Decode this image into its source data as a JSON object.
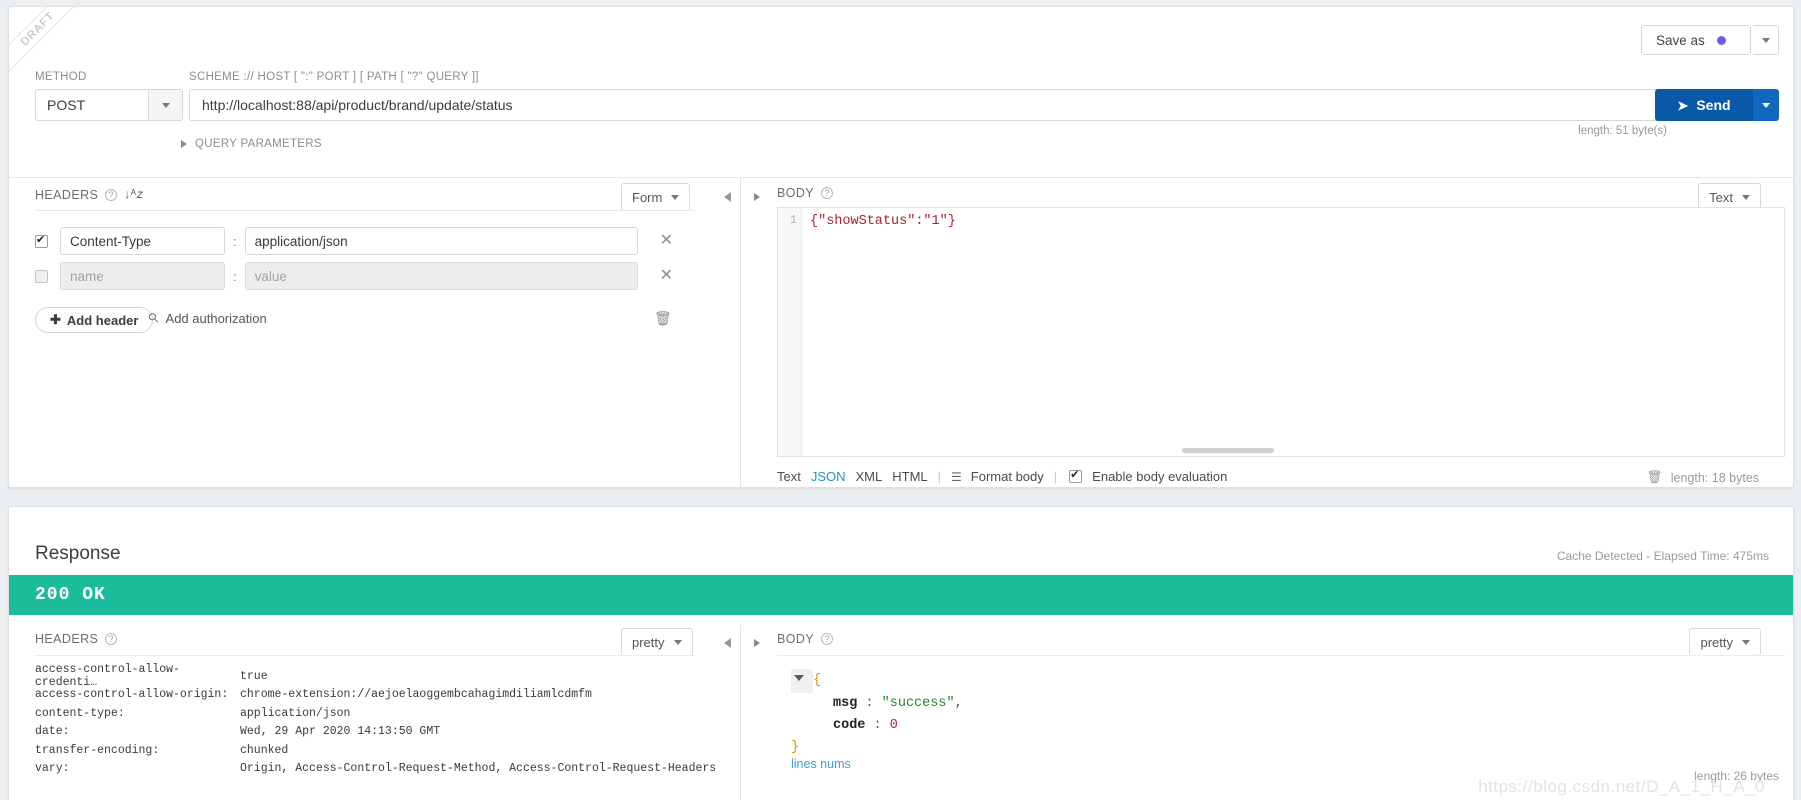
{
  "request": {
    "draft_badge": "DRAFT",
    "method_label": "METHOD",
    "method_value": "POST",
    "url_label": "SCHEME :// HOST [ \":\" PORT ] [ PATH [ \"?\" QUERY ]]",
    "url_value": "http://localhost:88/api/product/brand/update/status",
    "url_length": "length: 51 byte(s)",
    "save_as_label": "Save as",
    "save_as_dot_color": "#6f5ce0",
    "send_label": "Send",
    "send_color": "#0a59a8",
    "query_parameters_label": "QUERY PARAMETERS",
    "headers": {
      "title": "HEADERS",
      "view_mode": "Form",
      "rows": [
        {
          "enabled": true,
          "name": "Content-Type",
          "value": "application/json",
          "name_placeholder": "",
          "value_placeholder": ""
        },
        {
          "enabled": false,
          "name": "",
          "value": "",
          "name_placeholder": "name",
          "value_placeholder": "value"
        }
      ],
      "add_header_label": "Add header",
      "add_authorization_label": "Add authorization"
    },
    "body": {
      "title": "BODY",
      "view_mode": "Text",
      "line_number": "1",
      "content": "{\"showStatus\":\"1\"}",
      "formats": [
        "Text",
        "JSON",
        "XML",
        "HTML"
      ],
      "active_format": "JSON",
      "format_body_label": "Format body",
      "enable_body_evaluation_label": "Enable body evaluation",
      "enable_body_evaluation_checked": true,
      "length": "length: 18 bytes"
    }
  },
  "response": {
    "title": "Response",
    "meta": "Cache Detected - Elapsed Time: 475ms",
    "status_code": "200 OK",
    "status_color": "#1abc9c",
    "headers": {
      "title": "HEADERS",
      "view_mode": "pretty",
      "rows": [
        {
          "name": "access-control-allow-credenti…",
          "value": "true"
        },
        {
          "name": "access-control-allow-origin:",
          "value": "chrome-extension://aejoelaoggembcahagimdiliamlcdmfm"
        },
        {
          "name": "content-type:",
          "value": "application/json"
        },
        {
          "name": "date:",
          "value": "Wed, 29 Apr 2020 14:13:50 GMT"
        },
        {
          "name": "transfer-encoding:",
          "value": "chunked"
        },
        {
          "name": "vary:",
          "value": "Origin, Access-Control-Request-Method, Access-Control-Request-Headers"
        }
      ]
    },
    "body": {
      "title": "BODY",
      "view_mode": "pretty",
      "open_brace": "{",
      "close_brace": "}",
      "entries": [
        {
          "key": "msg",
          "colon": ":",
          "value": "\"success\"",
          "type": "string",
          "trailing": ","
        },
        {
          "key": "code",
          "colon": ":",
          "value": "0",
          "type": "number",
          "trailing": ""
        }
      ],
      "lines_nums_label": "lines nums",
      "length": "length: 26 bytes"
    }
  },
  "watermark": "https://blog.csdn.net/D_A_1_H_A_0"
}
